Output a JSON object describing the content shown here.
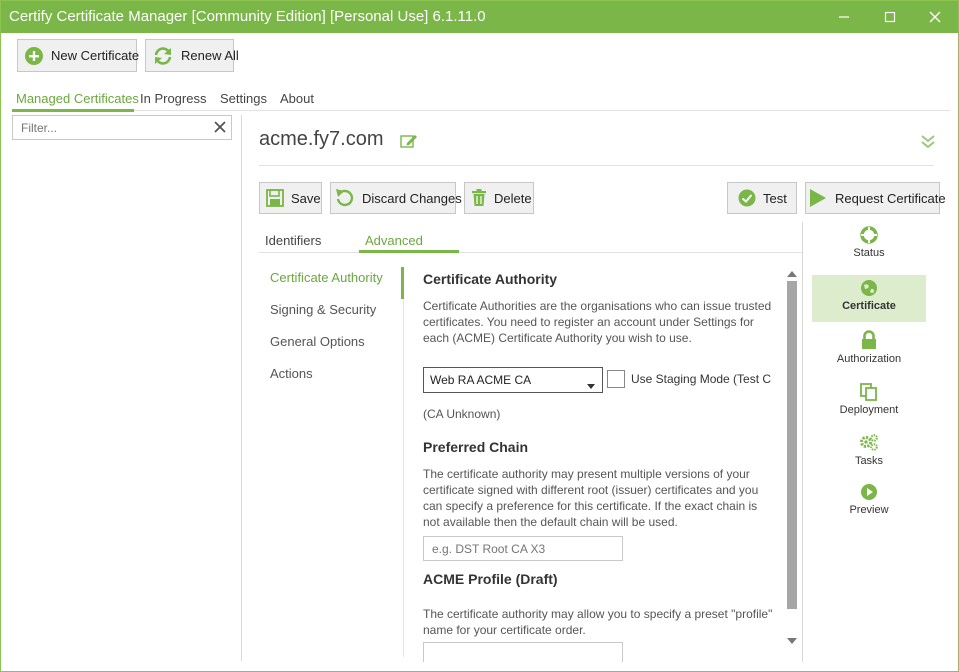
{
  "window": {
    "title": "Certify Certificate Manager [Community Edition] [Personal Use] 6.1.11.0"
  },
  "toolbar": {
    "new_certificate_label": "New Certificate",
    "renew_all_label": "Renew All"
  },
  "main_tabs": [
    {
      "label": "Managed Certificates",
      "active": true
    },
    {
      "label": "In Progress",
      "active": false
    },
    {
      "label": "Settings",
      "active": false
    },
    {
      "label": "About",
      "active": false
    }
  ],
  "filter": {
    "placeholder": "Filter..."
  },
  "certificate": {
    "name": "acme.fy7.com"
  },
  "actions": {
    "save_label": "Save",
    "discard_label": "Discard Changes",
    "delete_label": "Delete",
    "test_label": "Test",
    "request_label": "Request Certificate"
  },
  "sub_tabs": [
    {
      "label": "Identifiers",
      "active": false
    },
    {
      "label": "Advanced",
      "active": true
    }
  ],
  "advanced_nav": [
    {
      "label": "Certificate Authority",
      "active": true
    },
    {
      "label": "Signing & Security",
      "active": false
    },
    {
      "label": "General Options",
      "active": false
    },
    {
      "label": "Actions",
      "active": false
    }
  ],
  "ca_section": {
    "heading": "Certificate Authority",
    "description": "Certificate Authorities are the organisations who can issue trusted certificates. You need to register an account under Settings for each (ACME) Certificate Authority you wish to use.",
    "selected_ca": "Web RA ACME CA",
    "staging_label": "Use Staging Mode (Test C",
    "staging_checked": false,
    "ca_status": "(CA Unknown)"
  },
  "chain_section": {
    "heading": "Preferred Chain",
    "description": "The certificate authority may present multiple versions of your certificate signed with different root (issuer) certificates and you can specify a preference for this certificate. If the exact chain is not available then the default chain will be used.",
    "placeholder": "e.g. DST Root CA X3"
  },
  "profile_section": {
    "heading": "ACME Profile (Draft)",
    "description": "The certificate authority may allow you to specify a preset \"profile\" name for your certificate order."
  },
  "side_panel": [
    {
      "label": "Status",
      "icon": "lifebuoy-icon",
      "active": false
    },
    {
      "label": "Certificate",
      "icon": "globe-icon",
      "active": true
    },
    {
      "label": "Authorization",
      "icon": "lock-icon",
      "active": false
    },
    {
      "label": "Deployment",
      "icon": "copy-icon",
      "active": false
    },
    {
      "label": "Tasks",
      "icon": "gears-icon",
      "active": false
    },
    {
      "label": "Preview",
      "icon": "play-circle-icon",
      "active": false
    }
  ],
  "colors": {
    "accent": "#7ab648",
    "accent_text": "#6aa83c",
    "active_bg": "#dceccc"
  }
}
